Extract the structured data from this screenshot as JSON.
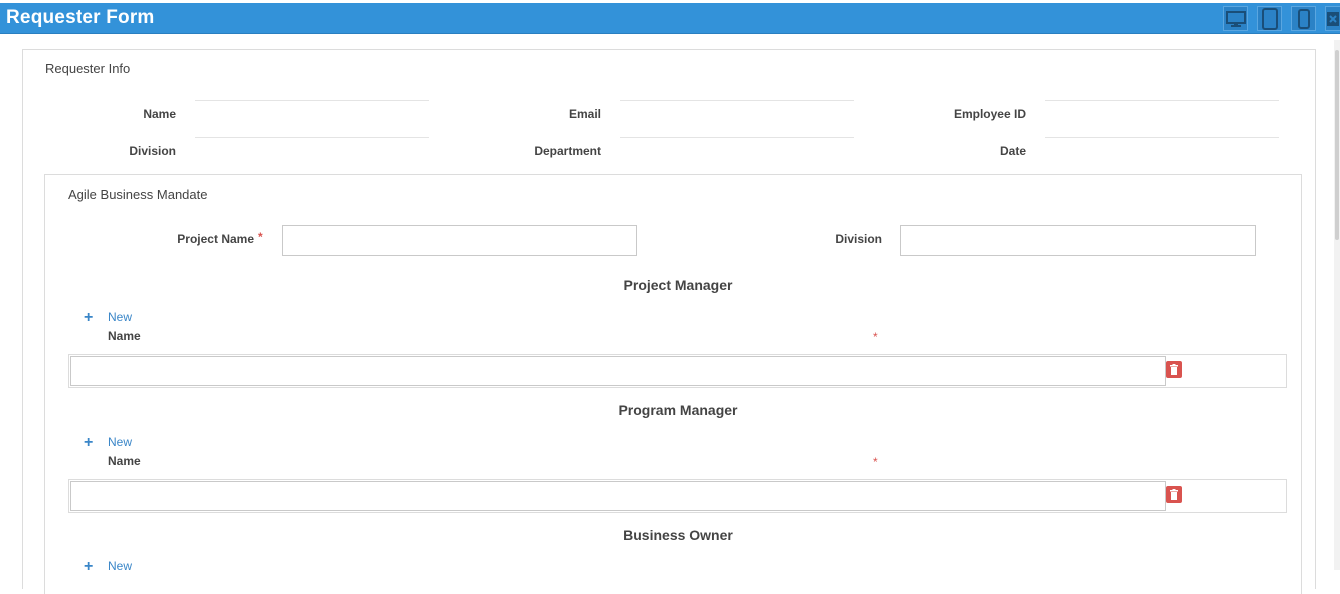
{
  "window": {
    "title": "Requester Form",
    "view_buttons": [
      {
        "name": "desktop-view-button",
        "icon": "monitor-icon"
      },
      {
        "name": "tablet-view-button",
        "icon": "tablet-icon"
      },
      {
        "name": "phone-view-button",
        "icon": "phone-icon"
      },
      {
        "name": "close-button",
        "icon": "close-icon"
      }
    ],
    "accent_color": "#3392d9"
  },
  "requester_info": {
    "title": "Requester Info",
    "fields": {
      "name": {
        "label": "Name",
        "value": ""
      },
      "email": {
        "label": "Email",
        "value": ""
      },
      "employee_id": {
        "label": "Employee ID",
        "value": ""
      },
      "division": {
        "label": "Division",
        "value": ""
      },
      "department": {
        "label": "Department",
        "value": ""
      },
      "date": {
        "label": "Date",
        "value": ""
      }
    }
  },
  "mandate": {
    "title": "Agile Business Mandate",
    "project_name": {
      "label": "Project Name",
      "required_mark": "*",
      "value": ""
    },
    "division": {
      "label": "Division",
      "value": ""
    },
    "groups": [
      {
        "title": "Project Manager",
        "new_label": "New",
        "column_label": "Name",
        "required_mark": "*",
        "rows": [
          ""
        ]
      },
      {
        "title": "Program Manager",
        "new_label": "New",
        "column_label": "Name",
        "required_mark": "*",
        "rows": [
          ""
        ]
      },
      {
        "title": "Business Owner",
        "new_label": "New"
      }
    ]
  }
}
